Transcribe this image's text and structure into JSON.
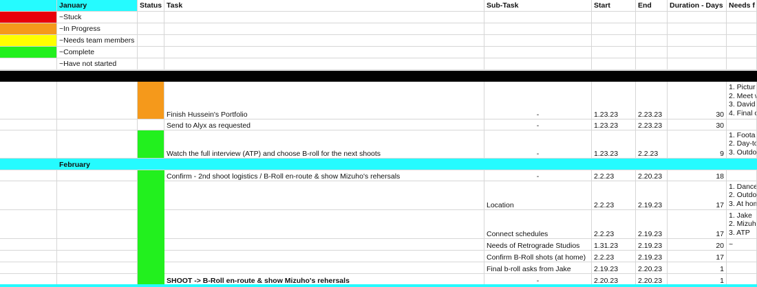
{
  "header": {
    "month": "January",
    "status": "Status",
    "task": "Task",
    "subtask": "Sub-Task",
    "start": "Start",
    "end": "End",
    "duration": "Duration - Days",
    "needs": "Needs f"
  },
  "legend": [
    {
      "label": "~Stuck",
      "color": "#e8000b"
    },
    {
      "label": "~In Progress",
      "color": "#f5991b"
    },
    {
      "label": "~Needs team members",
      "color": "#ffff00"
    },
    {
      "label": "~Complete",
      "color": "#22f01e"
    },
    {
      "label": "~Have not started",
      "color": ""
    }
  ],
  "colors": {
    "cyan": "#25fbff",
    "black": "#000000",
    "in_progress": "#f5991b",
    "complete": "#22f01e"
  },
  "january_rows": [
    {
      "task": "Finish Hussein's Portfolio",
      "subtask": "-",
      "start": "1.23.23",
      "end": "2.23.23",
      "duration": "30",
      "needs": [
        "1. Pictur",
        "2. Meet w",
        "3. David",
        "4. Final c"
      ]
    },
    {
      "task": "Send to Alyx as requested",
      "subtask": "-",
      "start": "1.23.23",
      "end": "2.23.23",
      "duration": "30",
      "needs": []
    },
    {
      "task": "Watch the full interview (ATP) and choose B-roll for the next shoots",
      "subtask": "-",
      "start": "1.23.23",
      "end": "2.2.23",
      "duration": "9",
      "needs": [
        "1. Foota",
        "2. Day-to",
        "3. Outdo"
      ]
    }
  ],
  "february_label": "February",
  "february_rows": [
    {
      "task": "Confirm - 2nd shoot logistics / B-Roll en-route & show Mizuho's rehersals",
      "subtask": "-",
      "start": "2.2.23",
      "end": "2.20.23",
      "duration": "18",
      "needs": []
    },
    {
      "task": "",
      "subtask": "Location",
      "start": "2.2.23",
      "end": "2.19.23",
      "duration": "17",
      "needs": [
        "1. Dance",
        "2. Outdo",
        "3. At hom"
      ]
    },
    {
      "task": "",
      "subtask": "Connect schedules",
      "start": "2.2.23",
      "end": "2.19.23",
      "duration": "17",
      "needs": [
        "1. Jake",
        "2. Mizuh",
        "3. ATP"
      ]
    },
    {
      "task": "",
      "subtask": "Needs of Retrograde Studios",
      "start": "1.31.23",
      "end": "2.19.23",
      "duration": "20",
      "needs": [
        "~"
      ]
    },
    {
      "task": "",
      "subtask": "Confirm B-Roll shots (at home)",
      "start": "2.2.23",
      "end": "2.19.23",
      "duration": "17",
      "needs": []
    },
    {
      "task": "",
      "subtask": "Final b-roll asks from Jake",
      "start": "2.19.23",
      "end": "2.20.23",
      "duration": "1",
      "needs": []
    },
    {
      "task": "SHOOT -> B-Roll en-route & show Mizuho's rehersals",
      "subtask": "-",
      "start": "2.20.23",
      "end": "2.20.23",
      "duration": "1",
      "needs": [],
      "bold": true
    }
  ]
}
